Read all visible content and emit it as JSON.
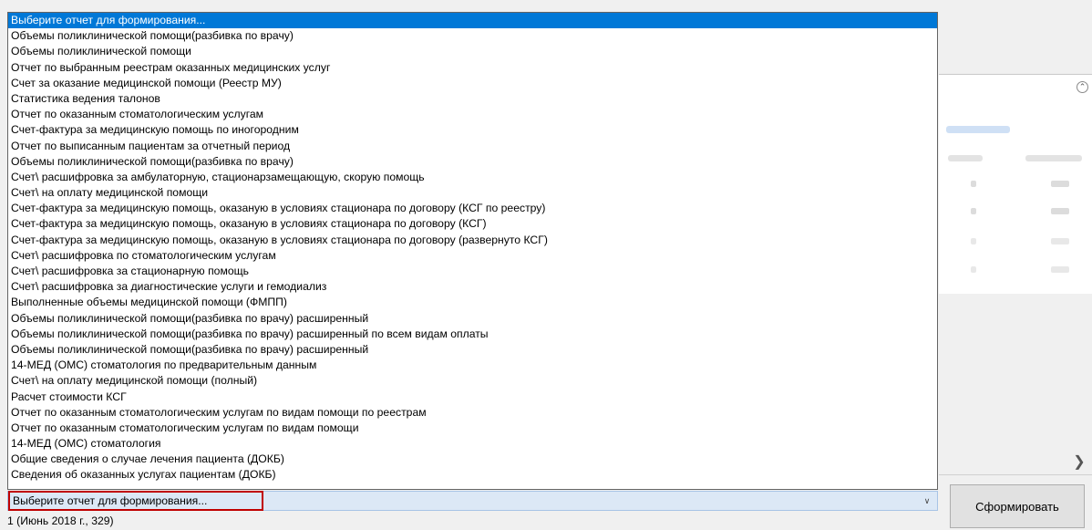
{
  "report_select": {
    "selected_label": "Выберите отчет для формирования...",
    "options": [
      "Выберите отчет для формирования...",
      "Объемы поликлинической помощи(разбивка  по врачу)",
      "Объемы поликлинической помощи",
      "Отчет по выбранным реестрам оказанных медицинских услуг",
      "Счет за оказание медицинской помощи (Реестр МУ)",
      "Статистика ведения талонов",
      "Отчет по оказанным стоматологическим услугам",
      "Счет-фактура за медицинскую помощь по иногородним",
      "Отчет по выписанным пациентам за отчетный период",
      "Объемы поликлинической помощи(разбивка  по врачу)",
      "Счет\\ расшифровка за амбулаторную, стационарзамещающую, скорую помощь",
      "Счет\\ на оплату медицинской помощи",
      "Счет-фактура за медицинскую помощь, оказаную в условиях стационара по договору (КСГ по реестру)",
      "Счет-фактура за медицинскую помощь, оказаную в условиях стационара по договору (КСГ)",
      "Счет-фактура за медицинскую помощь, оказаную в условиях стационара по договору (развернуто КСГ)",
      "Счет\\ расшифровка по стоматологическим услугам",
      "Счет\\ расшифровка за стационарную помощь",
      "Счет\\ расшифровка за диагностические услуги и гемодиализ",
      "Выполненные объемы медицинской помощи (ФМПП)",
      "Объемы поликлинической помощи(разбивка  по врачу) расширенный",
      "Объемы поликлинической помощи(разбивка  по врачу) расширенный по всем видам оплаты",
      "Объемы поликлинической помощи(разбивка  по врачу) расширенный",
      "14-МЕД (ОМС) стоматология по предварительным данным",
      "Счет\\ на оплату медицинской помощи (полный)",
      "Расчет стоимости КСГ",
      "Отчет по оказанным стоматологическим услугам по видам помощи по реестрам",
      "Отчет по оказанным стоматологическим услугам по видам помощи",
      "14-МЕД (ОМС) стоматология",
      "Общие сведения о случае лечения пациента (ДОКБ)",
      "Сведения об оказанных услугах пациентам (ДОКБ)"
    ],
    "arrow_icon": "chevron-down-icon"
  },
  "generate_button_label": "Сформировать",
  "status_text": "1 (Июнь 2018 г., 329)",
  "colors": {
    "selection": "#0078d7",
    "highlight_border": "#c00000",
    "combo_background": "#dce8f6"
  }
}
